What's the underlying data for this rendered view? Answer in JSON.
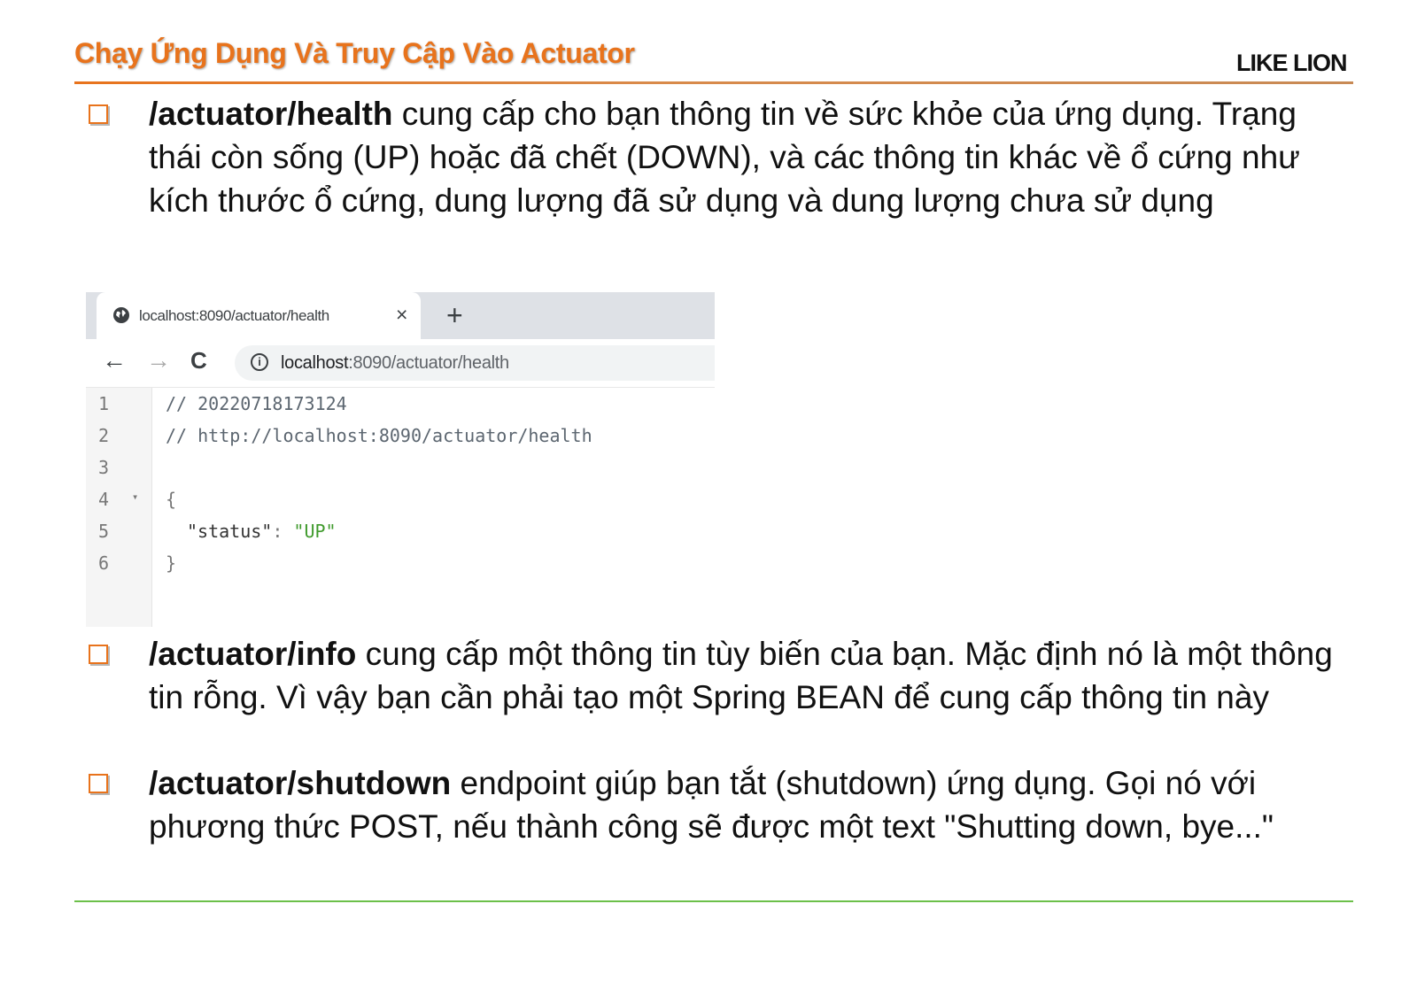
{
  "header": {
    "title": "Chạy Ứng Dụng Và Truy Cập Vào Actuator",
    "brand": "LIKE LION"
  },
  "bullets": [
    {
      "path": "/actuator/health",
      "text": " cung cấp cho bạn thông tin về sức khỏe của ứng dụng. Trạng thái còn sống (UP) hoặc đã chết (DOWN), và các thông tin khác về ổ cứng như kích thước ổ cứng, dung lượng đã sử dụng và dung lượng chưa sử dụng"
    },
    {
      "path": "/actuator/info",
      "text": " cung cấp một thông tin tùy biến của bạn. Mặc định nó là một thông tin rỗng. Vì vậy bạn cần phải tạo một Spring BEAN để cung cấp thông tin này"
    },
    {
      "path": "/actuator/shutdown",
      "text": " endpoint giúp bạn tắt (shutdown) ứng dụng. Gọi nó với phương thức POST, nếu thành công sẽ được một text \"Shutting down, bye...\""
    }
  ],
  "browser": {
    "tab_title": "localhost:8090/actuator/health",
    "tab_close": "×",
    "new_tab": "+",
    "back": "←",
    "forward": "→",
    "reload": "C",
    "url_host": "localhost",
    "url_rest": ":8090/actuator/health",
    "code": {
      "lines": [
        {
          "n": "1",
          "comment": "// 20220718173124"
        },
        {
          "n": "2",
          "comment": "// http://localhost:8090/actuator/health"
        },
        {
          "n": "3"
        },
        {
          "n": "4",
          "fold": "▾",
          "brace": "{"
        },
        {
          "n": "5",
          "key": "\"status\"",
          "colon": ": ",
          "value": "\"UP\""
        },
        {
          "n": "6",
          "brace": "}"
        }
      ]
    }
  }
}
